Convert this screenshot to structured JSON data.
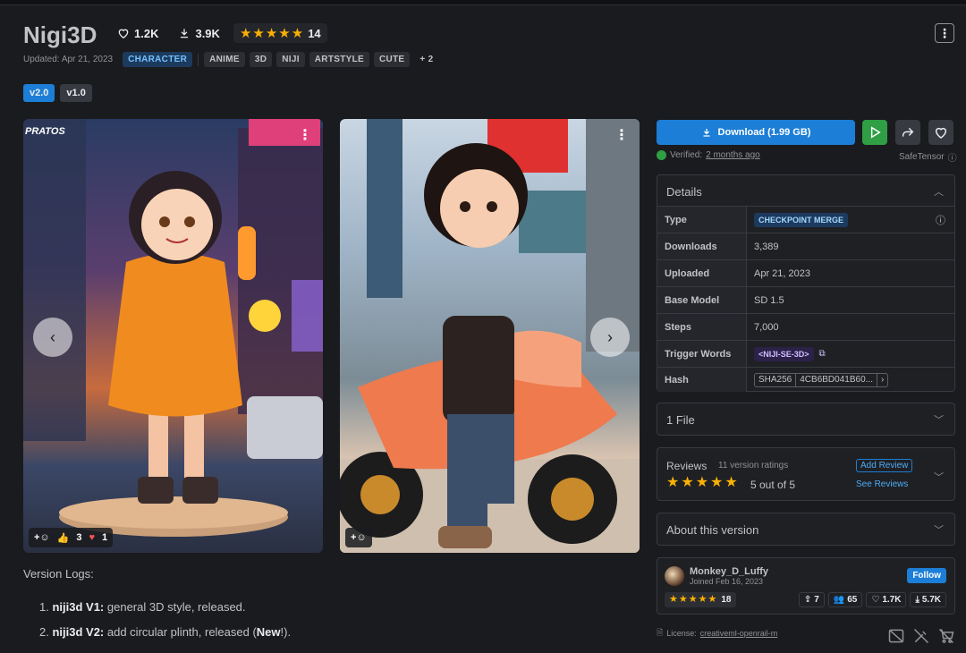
{
  "header": {
    "title": "Nigi3D",
    "likes": "1.2K",
    "downloads": "3.9K",
    "rating_count": "14",
    "updated": "Updated: Apr 21, 2023",
    "tags": [
      "ANIME",
      "3D",
      "NIJI",
      "ARTSTYLE",
      "CUTE"
    ],
    "category_tag": "CHARACTER",
    "more_tags": "+ 2"
  },
  "versions": [
    "v2.0",
    "v1.0"
  ],
  "logs": {
    "title": "Version Logs:",
    "items": [
      {
        "num": "1.",
        "name": "niji3d V1:",
        "text": " general 3D style, released."
      },
      {
        "num": "2.",
        "name": "niji3d V2:",
        "text": " add circular plinth, released (",
        "bold": "New",
        "tail": "!)."
      }
    ]
  },
  "images": [
    {
      "reactions": {
        "thumbs": "3",
        "hearts": "1"
      },
      "watermark": "PRATOS"
    },
    {}
  ],
  "download": {
    "label": "Download (1.99 GB)",
    "verified_prefix": "Verified:",
    "verified_time": "2 months ago",
    "format": "SafeTensor"
  },
  "details": {
    "title": "Details",
    "rows": [
      {
        "k": "Type",
        "v": "CHECKPOINT MERGE"
      },
      {
        "k": "Downloads",
        "v": "3,389"
      },
      {
        "k": "Uploaded",
        "v": "Apr 21, 2023"
      },
      {
        "k": "Base Model",
        "v": "SD 1.5"
      },
      {
        "k": "Steps",
        "v": "7,000"
      },
      {
        "k": "Trigger Words",
        "v": "<NIJI-SE-3D>"
      },
      {
        "k": "Hash",
        "v": "4CB6BD041B60...",
        "algo": "SHA256"
      }
    ]
  },
  "files": {
    "title": "1 File"
  },
  "reviews": {
    "title": "Reviews",
    "count": "11 version ratings",
    "score": "5 out of 5",
    "add": "Add Review",
    "see": "See Reviews"
  },
  "about": {
    "title": "About this version"
  },
  "creator": {
    "name": "Monkey_D_Luffy",
    "joined": "Joined Feb 16, 2023",
    "follow": "Follow",
    "rating": "18",
    "uploads": "7",
    "followers": "65",
    "likes": "1.7K",
    "downloads": "5.7K"
  },
  "license": {
    "prefix": "License:",
    "name": "creativeml-openrail-m"
  },
  "colors": {
    "accent": "#1c7ed6",
    "play": "#2f9e44",
    "star": "#fab005"
  }
}
